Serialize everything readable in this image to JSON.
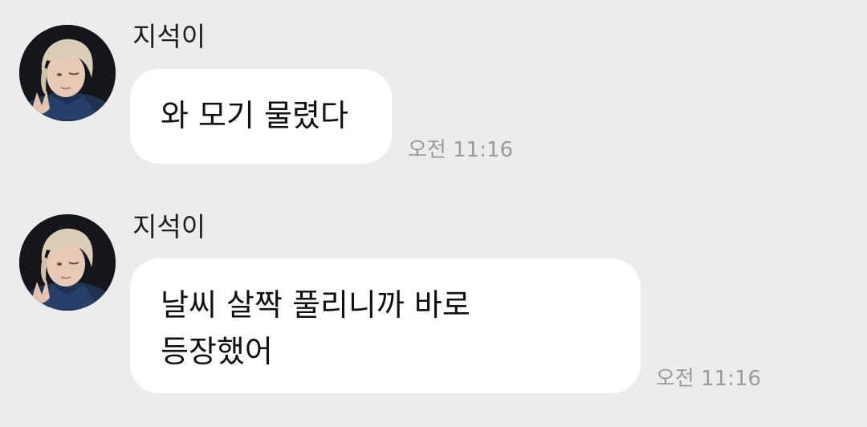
{
  "conversation": {
    "messages": [
      {
        "sender": "지석이",
        "lines": [
          "와 모기 물렸다"
        ],
        "time": "오전 11:16"
      },
      {
        "sender": "지석이",
        "lines": [
          "날씨 살짝 풀리니까 바로",
          "등장했어"
        ],
        "time": "오전 11:16"
      }
    ]
  }
}
